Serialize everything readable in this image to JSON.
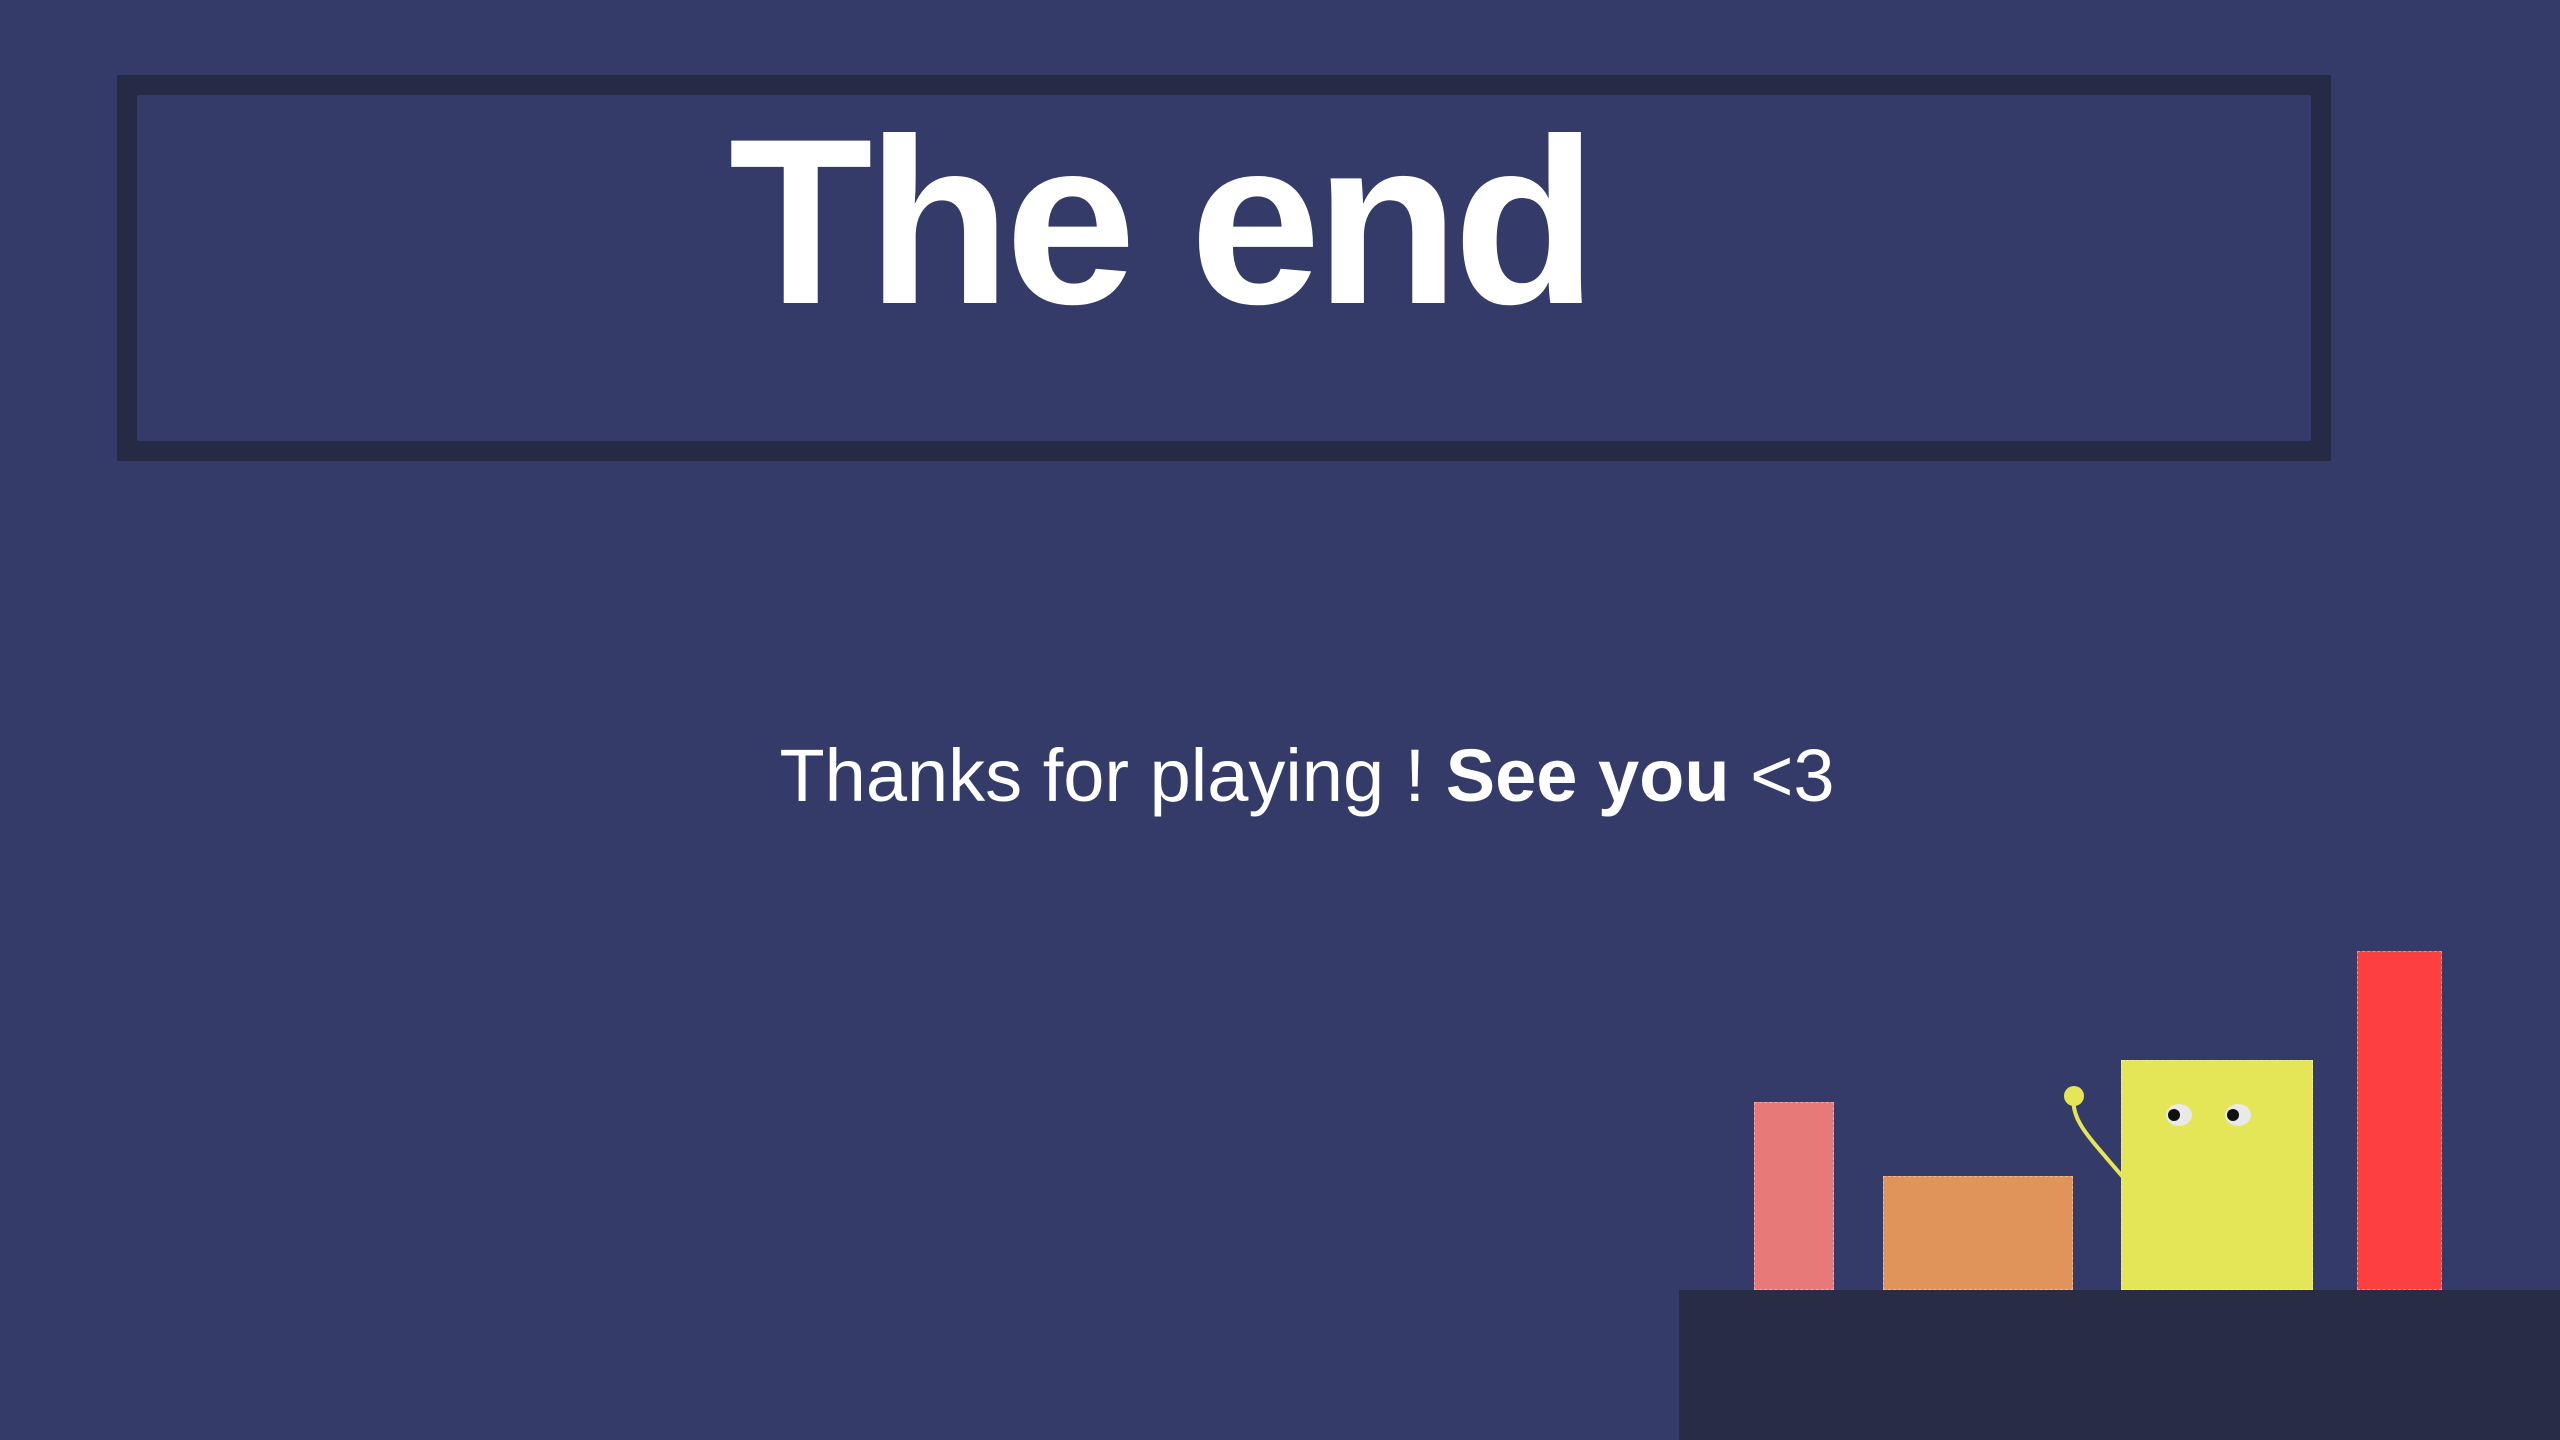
{
  "title": "The end",
  "message": {
    "text_before": "Thanks for playing ! ",
    "text_bold": "See you",
    "text_after": " <3"
  },
  "colors": {
    "background": "#343b68",
    "frame": "#262b45",
    "ground": "#282c44",
    "block_pink": "#e87979",
    "block_orange": "#e09459",
    "character_yellow": "#e4e658",
    "block_red": "#fd3f40"
  }
}
